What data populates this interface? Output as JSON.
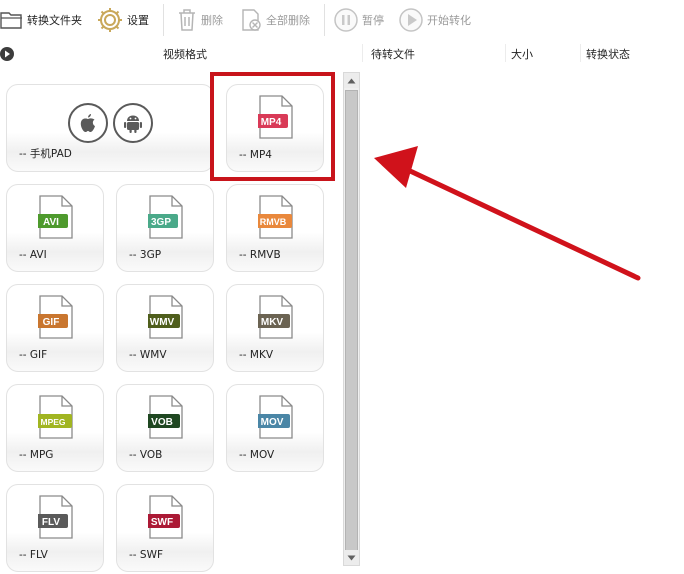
{
  "toolbar": {
    "convert_folder_label": "转换文件夹",
    "settings_label": "设置",
    "delete_label": "删除",
    "delete_all_label": "全部删除",
    "pause_label": "暂停",
    "start_label": "开始转化"
  },
  "header": {
    "format_col": "视频格式",
    "pending_col": "待转文件",
    "size_col": "大小",
    "status_col": "转换状态"
  },
  "formats": {
    "tablet": {
      "label": "-- 手机PAD"
    },
    "mp4": {
      "badge": "MP4",
      "label": "-- MP4",
      "color": "#d93a57",
      "selected": true
    },
    "avi": {
      "badge": "AVI",
      "label": "-- AVI",
      "color": "#4e9a2d"
    },
    "3gp": {
      "badge": "3GP",
      "label": "-- 3GP",
      "color": "#4aa989"
    },
    "rmvb": {
      "badge": "RMVB",
      "label": "-- RMVB",
      "color": "#e9883c"
    },
    "gif": {
      "badge": "GIF",
      "label": "-- GIF",
      "color": "#c9762f"
    },
    "wmv": {
      "badge": "WMV",
      "label": "-- WMV",
      "color": "#4f5e1c"
    },
    "mkv": {
      "badge": "MKV",
      "label": "-- MKV",
      "color": "#6b6352"
    },
    "mpeg": {
      "badge": "MPEG",
      "label": "-- MPG",
      "color": "#a1b521"
    },
    "vob": {
      "badge": "VOB",
      "label": "-- VOB",
      "color": "#1f4721"
    },
    "mov": {
      "badge": "MOV",
      "label": "-- MOV",
      "color": "#4a86a6"
    },
    "flv": {
      "badge": "FLV",
      "label": "-- FLV",
      "color": "#5a5a5a"
    },
    "swf": {
      "badge": "SWF",
      "label": "-- SWF",
      "color": "#ab1935"
    }
  },
  "annotation": {
    "color": "#d0121b"
  }
}
